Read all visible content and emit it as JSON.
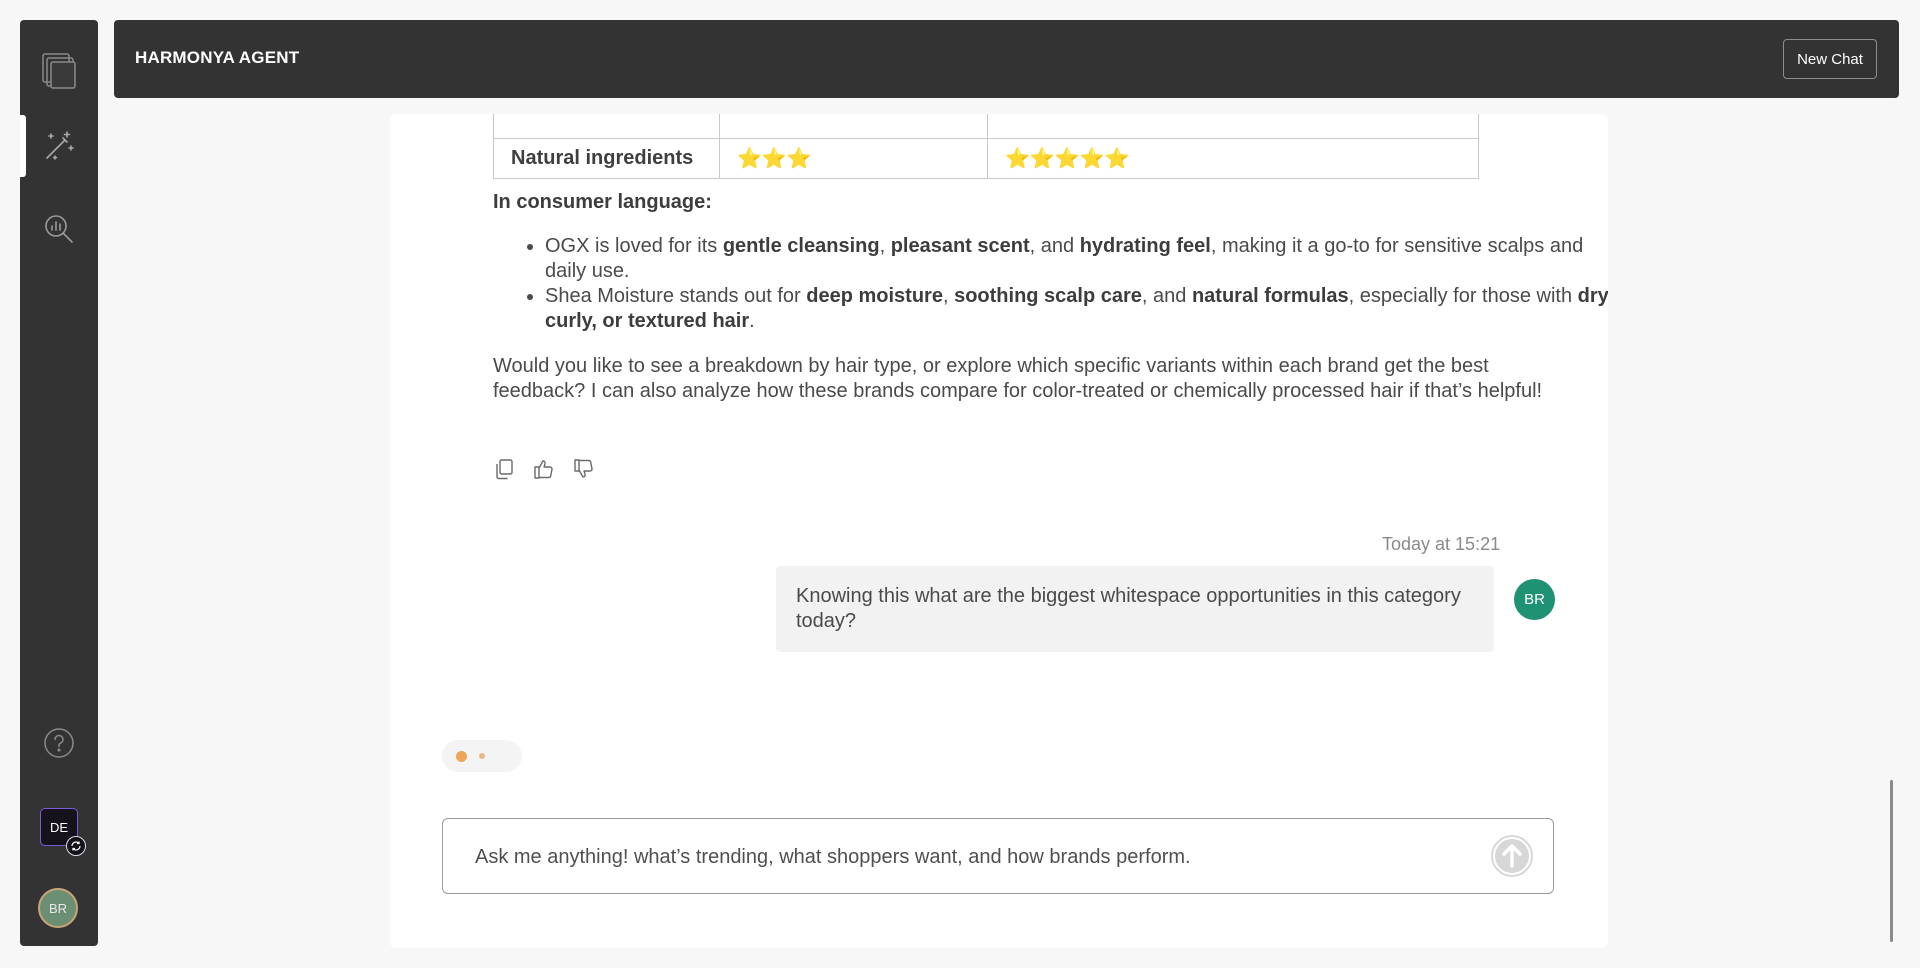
{
  "app": {
    "title": "HARMONYA AGENT",
    "new_chat_label": "New Chat"
  },
  "sidebar": {
    "icons": [
      "layers-logo-icon",
      "magic-wand-icon",
      "chart-search-icon",
      "help-icon"
    ],
    "workspace_badge": "DE",
    "user_initials": "BR"
  },
  "chat": {
    "table": {
      "rows": [
        {
          "label": "",
          "ogx": "",
          "shea": ""
        },
        {
          "label": "Natural ingredients",
          "ogx": "⭐⭐⭐",
          "shea": "⭐⭐⭐⭐⭐"
        }
      ]
    },
    "consumer_heading": "In consumer language:",
    "bullet1": {
      "t1": "OGX is loved for its ",
      "b1": "gentle cleansing",
      "t2": ", ",
      "b2": "pleasant scent",
      "t3": ", and ",
      "b3": "hydrating feel",
      "t4": ", making it a go-to for sensitive scalps and daily use."
    },
    "bullet2": {
      "t1": "Shea Moisture stands out for ",
      "b1": "deep moisture",
      "t2": ", ",
      "b2": "soothing scalp care",
      "t3": ", and ",
      "b3": "natural formulas",
      "t4": ", especially for those with ",
      "b4": "dry, curly, or textured hair",
      "t5": "."
    },
    "followup": "Would you like to see a breakdown by hair type, or explore which specific variants within each brand get the best feedback? I can also analyze how these brands compare for color-treated or chemically processed hair if that’s helpful!",
    "user_message": {
      "timestamp": "Today at 15:21",
      "text": "Knowing this what are the biggest whitespace opportunities in this category today?",
      "initials": "BR"
    },
    "input": {
      "placeholder": "Ask me anything! what’s trending, what shoppers want, and how brands perform.",
      "value": ""
    }
  },
  "colors": {
    "sidebar_bg": "#333333",
    "avatar_green": "#1f9273",
    "typing_dot": "#f0a458"
  }
}
